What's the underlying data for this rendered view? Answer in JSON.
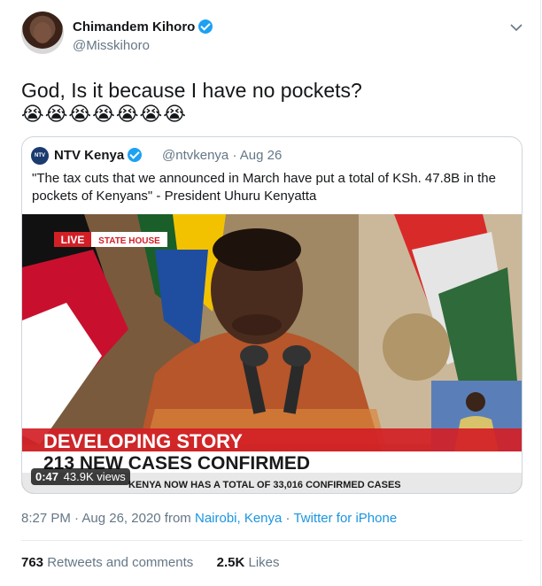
{
  "author": {
    "name": "Chimandem Kihoro",
    "handle": "@Misskihoro"
  },
  "tweet": {
    "text": "God, Is it because I have no pockets?",
    "emoji": "😭😭😭😭😭😭😭"
  },
  "quoted": {
    "logo_text": "NTV",
    "name": "NTV Kenya",
    "handle": "@ntvkenya",
    "separator": "·",
    "date": "Aug 26",
    "text": "\"The tax cuts that we announced in March have put a total of KSh. 47.8B in the pockets of Kenyans\" - President Uhuru Kenyatta",
    "video": {
      "live_label": "LIVE",
      "source_label": "STATE HOUSE",
      "banner_top": "DEVELOPING STORY",
      "banner_main": "213 NEW CASES CONFIRMED",
      "ticker": "KENYA NOW HAS A TOTAL OF 33,016 CONFIRMED CASES",
      "duration": "0:47",
      "views": "43.9K views"
    }
  },
  "meta": {
    "time": "8:27 PM",
    "sep1": "·",
    "date": "Aug 26, 2020 from",
    "location": "Nairobi, Kenya",
    "sep2": "·",
    "source": "Twitter for iPhone"
  },
  "stats": {
    "retweets_count": "763",
    "retweets_label": "Retweets and comments",
    "likes_count": "2.5K",
    "likes_label": "Likes"
  },
  "colors": {
    "accent": "#1da1f2",
    "link": "#1b95e0",
    "muted": "#657786",
    "banner_red": "#d21f26",
    "banner_white": "#ffffff"
  }
}
